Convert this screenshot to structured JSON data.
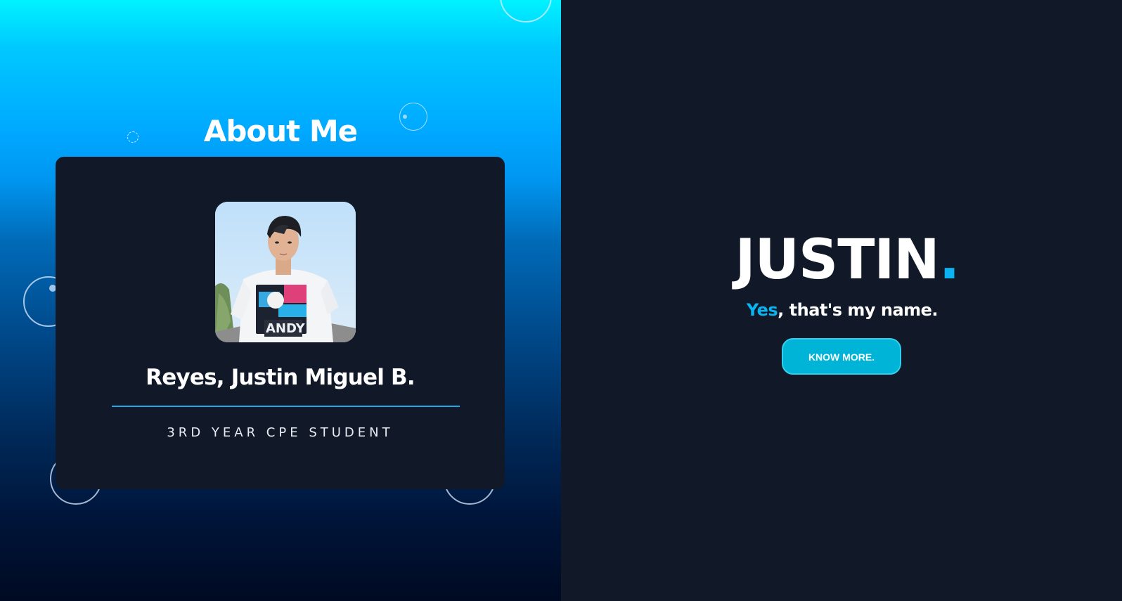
{
  "about": {
    "title": "About Me"
  },
  "profile": {
    "photo_alt": "Profile photo",
    "name": "Reyes, Justin Miguel B.",
    "role": "3RD YEAR CPE STUDENT"
  },
  "hero": {
    "name": "JUSTIN",
    "name_dot": ".",
    "tagline_highlight": "Yes",
    "tagline_rest": ", that's my name.",
    "cta_label": "KNOW MORE."
  },
  "colors": {
    "accent": "#0ab4f0",
    "card_bg": "#111827",
    "cta_bg": "#00b4d8",
    "page_bg_right": "#111827"
  }
}
